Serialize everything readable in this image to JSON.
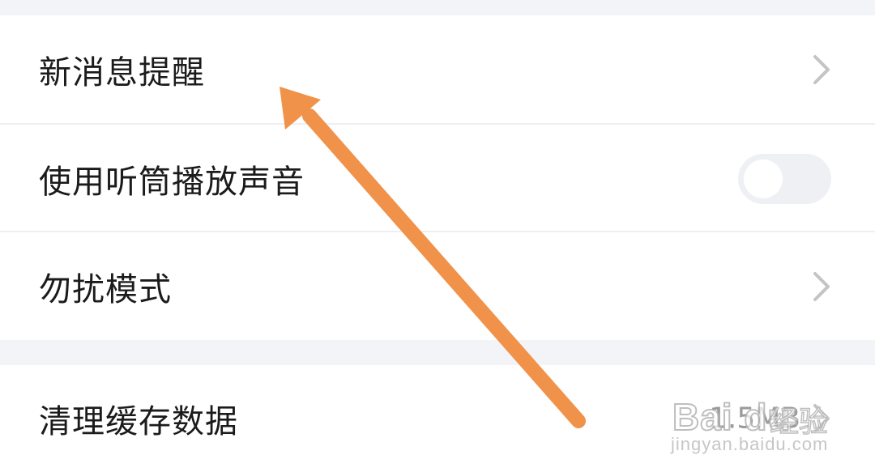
{
  "settings": {
    "items": [
      {
        "label": "新消息提醒",
        "control": "chevron"
      },
      {
        "label": "使用听筒播放声音",
        "control": "toggle",
        "enabled": false
      },
      {
        "label": "勿扰模式",
        "control": "chevron"
      },
      {
        "label": "清理缓存数据",
        "control": "value"
      }
    ],
    "cache_value": "1.5MB"
  },
  "annotation": {
    "arrow_color": "#f0924a",
    "points_to": "新消息提醒"
  },
  "watermark": {
    "brand": "Bai du",
    "product": "经验",
    "url": "jingyan.baidu.com"
  }
}
